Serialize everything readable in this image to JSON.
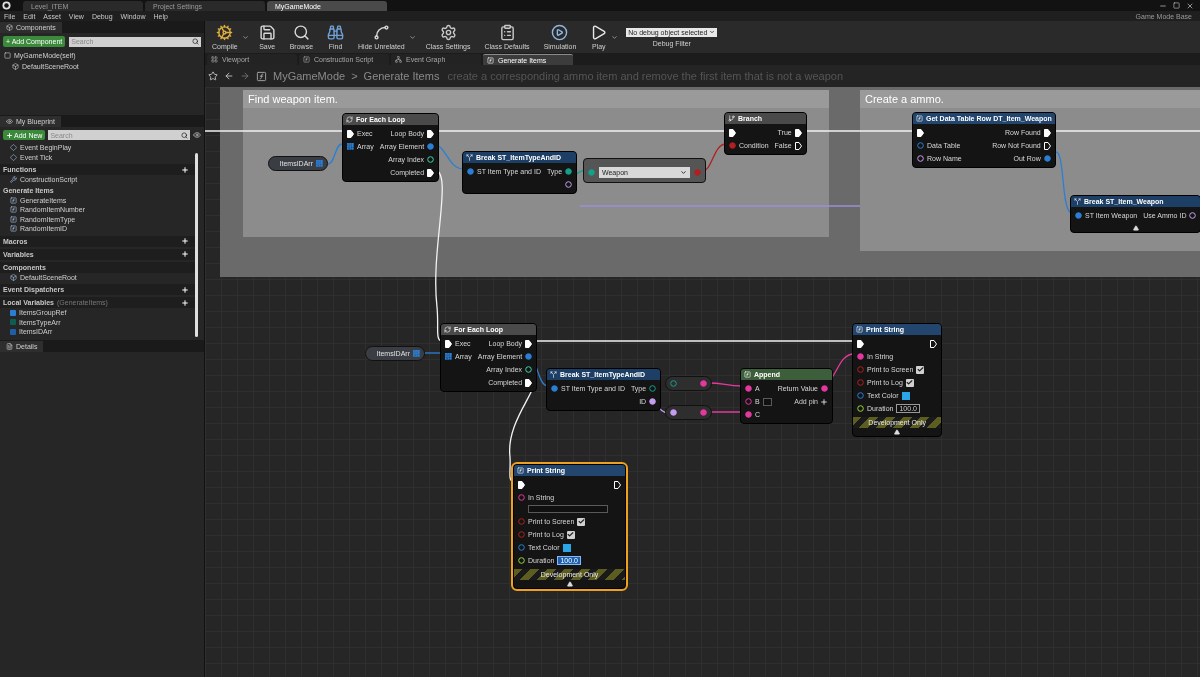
{
  "editor_tabs": [
    {
      "label": "Level_ITEM",
      "selected": false
    },
    {
      "label": "Project Settings",
      "selected": false
    },
    {
      "label": "MyGameMode",
      "selected": true
    }
  ],
  "menu": [
    "File",
    "Edit",
    "Asset",
    "View",
    "Debug",
    "Window",
    "Help"
  ],
  "parent_class": "Game Mode Base",
  "components_panel": {
    "title": "Components",
    "add_button": "+ Add Component",
    "search": {
      "placeholder": "Search"
    },
    "tree": [
      {
        "label": "MyGameMode(self)",
        "children": [
          {
            "label": "DefaultSceneRoot"
          }
        ]
      }
    ]
  },
  "my_blueprint": {
    "title": "My Blueprint",
    "add_button": "Add New",
    "search": {
      "placeholder": "Search"
    },
    "sections": [
      {
        "kind": "plain",
        "items": [
          {
            "label": "Event BeginPlay",
            "kind": "event"
          },
          {
            "label": "Event Tick",
            "kind": "event"
          }
        ]
      },
      {
        "kind": "section",
        "title": "Functions",
        "add": true,
        "items": [
          {
            "label": "ConstructionScript",
            "kind": "construction"
          }
        ]
      },
      {
        "kind": "category",
        "title": "Generate Items",
        "add": false,
        "items": [
          {
            "label": "GenerateItems",
            "kind": "function"
          },
          {
            "label": "RandomItemNumber",
            "kind": "function"
          },
          {
            "label": "RandomItemType",
            "kind": "function"
          },
          {
            "label": "RandomItemID",
            "kind": "function"
          }
        ]
      },
      {
        "kind": "section",
        "title": "Macros",
        "add": true
      },
      {
        "kind": "section",
        "title": "Variables",
        "add": true
      },
      {
        "kind": "section",
        "title": "Components",
        "add": false,
        "items": [
          {
            "label": "DefaultSceneRoot",
            "kind": "component"
          }
        ]
      },
      {
        "kind": "section",
        "title": "Event Dispatchers",
        "add": true
      },
      {
        "kind": "section",
        "title": "Local Variables",
        "hint": "(GenerateItems)",
        "add": true,
        "items": [
          {
            "label": "ItemsGroupRef",
            "kind": "variable",
            "color": "#2a7fd4"
          },
          {
            "label": "ItemsTypeArr",
            "kind": "variable",
            "color": "#0d5d52"
          },
          {
            "label": "ItemsIDArr",
            "kind": "variable",
            "color": "#1f5fa8"
          }
        ]
      }
    ]
  },
  "details_tab": "Details",
  "toolbar": [
    {
      "label": "Compile",
      "dropdown": true
    },
    {
      "label": "Save",
      "dropdown": false
    },
    {
      "label": "Browse",
      "dropdown": false
    },
    {
      "label": "Find",
      "dropdown": false
    },
    {
      "label": "Hide Unrelated",
      "dropdown": true
    },
    {
      "label": "Class Settings",
      "dropdown": false
    },
    {
      "label": "Class Defaults",
      "dropdown": false
    },
    {
      "label": "Simulation",
      "dropdown": false
    },
    {
      "label": "Play",
      "dropdown": true
    }
  ],
  "debug_filter": {
    "value": "No debug object selected",
    "label": "Debug Filter"
  },
  "graph_tabs": [
    {
      "label": "Viewport",
      "selected": false
    },
    {
      "label": "Construction Script",
      "selected": false
    },
    {
      "label": "Event Graph",
      "selected": false
    },
    {
      "label": "Generate Items",
      "selected": true
    }
  ],
  "breadcrumb": {
    "path": [
      "MyGameMode",
      "Generate Items"
    ],
    "separator": ">",
    "comment": "create a corresponding ammo item and remove the first item that is not a weapon"
  },
  "comments": [
    {
      "title": "Find weapon item."
    },
    {
      "title": "Create a ammo."
    }
  ],
  "nodes": [
    {
      "kind": "variable",
      "label": "ItemsIDArr",
      "selected": false,
      "right": [
        {
          "kind": "array",
          "connected": true
        }
      ]
    },
    {
      "kind": "macro",
      "title": "For Each Loop",
      "selected": false,
      "expand_arrow": false,
      "left": [
        {
          "label": "Exec",
          "kind": "exec",
          "connected": true
        },
        {
          "label": "Array",
          "kind": "array",
          "connected": true
        }
      ],
      "right": [
        {
          "label": "Loop Body",
          "kind": "exec",
          "connected": true
        },
        {
          "label": "Array Element",
          "kind": "struct",
          "connected": true
        },
        {
          "label": "Array Index",
          "kind": "int",
          "connected": false
        },
        {
          "label": "Completed",
          "kind": "exec",
          "connected": true
        }
      ]
    },
    {
      "kind": "struct",
      "title": "Break ST_ItemTypeAndID",
      "selected": false,
      "expand_arrow": false,
      "left": [
        {
          "label": "ST Item Type and ID",
          "kind": "struct",
          "connected": true
        }
      ],
      "right": [
        {
          "label": "Type",
          "kind": "byte",
          "connected": true
        },
        {
          "kind": "name",
          "connected": false
        }
      ]
    },
    {
      "kind": "compare",
      "selected": false,
      "dropdown": "Weapon",
      "left": [
        {
          "kind": "byte",
          "connected": true
        }
      ],
      "right": [
        {
          "kind": "bool",
          "connected": true
        }
      ]
    },
    {
      "kind": "branch",
      "title": "Branch",
      "selected": false,
      "expand_arrow": false,
      "left": [
        {
          "kind": "exec",
          "connected": true
        },
        {
          "label": "Condition",
          "kind": "bool",
          "connected": true
        }
      ],
      "right": [
        {
          "label": "True",
          "kind": "exec",
          "connected": true
        },
        {
          "label": "False",
          "kind": "exec",
          "connected": false
        }
      ]
    },
    {
      "kind": "function",
      "title": "Get Data Table Row DT_Item_Weapon",
      "selected": false,
      "expand_arrow": false,
      "left": [
        {
          "kind": "exec",
          "connected": true
        },
        {
          "label": "Data Table",
          "kind": "object",
          "connected": false
        },
        {
          "label": "Row Name",
          "kind": "name",
          "connected": false
        }
      ],
      "right": [
        {
          "label": "Row Found",
          "kind": "exec",
          "connected": true
        },
        {
          "label": "Row Not Found",
          "kind": "exec",
          "connected": false
        },
        {
          "label": "Out Row",
          "kind": "struct",
          "connected": true
        }
      ]
    },
    {
      "kind": "struct",
      "title": "Break ST_Item_Weapon",
      "selected": false,
      "expand_arrow": true,
      "left": [
        {
          "label": "ST Item Weapon",
          "kind": "struct",
          "connected": true
        }
      ],
      "right": [
        {
          "label": "Use Ammo ID",
          "kind": "name",
          "connected": false
        }
      ]
    },
    {
      "kind": "variable",
      "label": "ItemsIDArr",
      "selected": false,
      "right": [
        {
          "kind": "array",
          "connected": true
        }
      ]
    },
    {
      "kind": "macro",
      "title": "For Each Loop",
      "selected": false,
      "expand_arrow": false,
      "left": [
        {
          "label": "Exec",
          "kind": "exec",
          "connected": true
        },
        {
          "label": "Array",
          "kind": "array",
          "connected": true
        }
      ],
      "right": [
        {
          "label": "Loop Body",
          "kind": "exec",
          "connected": true
        },
        {
          "label": "Array Element",
          "kind": "struct",
          "connected": true
        },
        {
          "label": "Array Index",
          "kind": "int",
          "connected": false
        },
        {
          "label": "Completed",
          "kind": "exec",
          "connected": true
        }
      ]
    },
    {
      "kind": "struct",
      "title": "Break ST_ItemTypeAndID",
      "selected": false,
      "expand_arrow": false,
      "left": [
        {
          "label": "ST Item Type and ID",
          "kind": "struct",
          "connected": true
        }
      ],
      "right": [
        {
          "label": "Type",
          "kind": "byte",
          "connected": false
        },
        {
          "label": "ID",
          "kind": "name",
          "connected": true
        }
      ]
    },
    {
      "kind": "convert",
      "selected": false,
      "left": [
        {
          "kind": "byte",
          "connected": false
        }
      ],
      "right": [
        {
          "kind": "string",
          "connected": true
        }
      ]
    },
    {
      "kind": "convert",
      "selected": false,
      "left": [
        {
          "kind": "name",
          "connected": true
        }
      ],
      "right": [
        {
          "kind": "string",
          "connected": true
        }
      ]
    },
    {
      "kind": "pure",
      "title": "Append",
      "selected": false,
      "expand_arrow": false,
      "left": [
        {
          "label": "A",
          "kind": "string",
          "connected": true
        },
        {
          "label": "B",
          "kind": "string",
          "connected": false,
          "text_box": true,
          "box_below": false
        },
        {
          "label": "C",
          "kind": "string",
          "connected": true
        }
      ],
      "right": [
        {
          "label": "Return Value",
          "kind": "string",
          "connected": true
        },
        {
          "label": "Add pin",
          "kind": "add"
        }
      ]
    },
    {
      "kind": "function",
      "title": "Print String",
      "selected": false,
      "expand_arrow": true,
      "footer": "Development Only",
      "left": [
        {
          "kind": "exec",
          "connected": true
        },
        {
          "label": "In String",
          "kind": "string",
          "connected": true
        },
        {
          "label": "Print to Screen",
          "kind": "bool",
          "connected": false,
          "checked": true
        },
        {
          "label": "Print to Log",
          "kind": "bool",
          "connected": false,
          "checked": true
        },
        {
          "label": "Text Color",
          "kind": "color",
          "connected": false,
          "color": "#2aa6e8"
        },
        {
          "label": "Duration",
          "kind": "float",
          "connected": false,
          "value": "100.0",
          "focused": false
        }
      ],
      "right": [
        {
          "kind": "exec",
          "connected": false
        }
      ]
    },
    {
      "kind": "function",
      "title": "Print String",
      "selected": true,
      "expand_arrow": true,
      "footer": "Development Only",
      "left": [
        {
          "kind": "exec",
          "connected": true
        },
        {
          "label": "In String",
          "kind": "string",
          "connected": false,
          "text_box": true,
          "box_below": true
        },
        {
          "label": "Print to Screen",
          "kind": "bool",
          "connected": false,
          "checked": true
        },
        {
          "label": "Print to Log",
          "kind": "bool",
          "connected": false,
          "checked": true
        },
        {
          "label": "Text Color",
          "kind": "color",
          "connected": false,
          "color": "#2aa6e8"
        },
        {
          "label": "Duration",
          "kind": "float",
          "connected": false,
          "value": "100.0",
          "focused": true
        }
      ],
      "right": [
        {
          "kind": "exec",
          "connected": false
        }
      ]
    }
  ]
}
